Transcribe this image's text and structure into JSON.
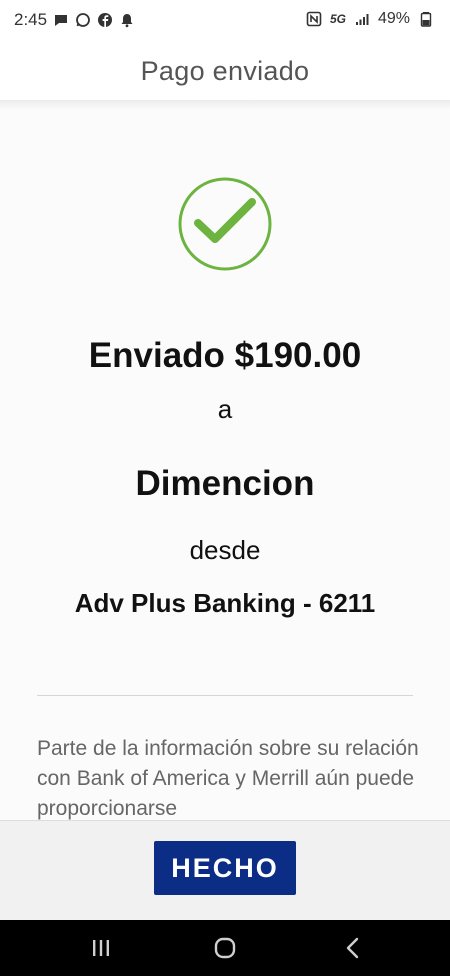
{
  "status_bar": {
    "time": "2:45",
    "network": "5G",
    "battery": "49%",
    "left_icons": [
      "message-icon",
      "whatsapp-icon",
      "facebook-icon",
      "bell-icon"
    ],
    "right_icons": [
      "nfc-icon",
      "signal-icon",
      "battery-icon"
    ]
  },
  "header": {
    "title": "Pago enviado"
  },
  "confirmation": {
    "icon": "check-circle-icon",
    "icon_color": "#6cb33f",
    "amount_line": "Enviado $190.00",
    "to_word": "a",
    "recipient": "Dimencion",
    "from_word": "desde",
    "account": "Adv Plus Banking - 6211"
  },
  "disclaimer": {
    "text": "Parte de la información sobre su relación con Bank of America y Merrill aún puede proporcionarse"
  },
  "footer": {
    "done_label": "HECHO",
    "button_color": "#0b2d86"
  },
  "nav_bar": {
    "buttons": [
      "recent-apps-icon",
      "home-icon",
      "back-icon"
    ]
  }
}
